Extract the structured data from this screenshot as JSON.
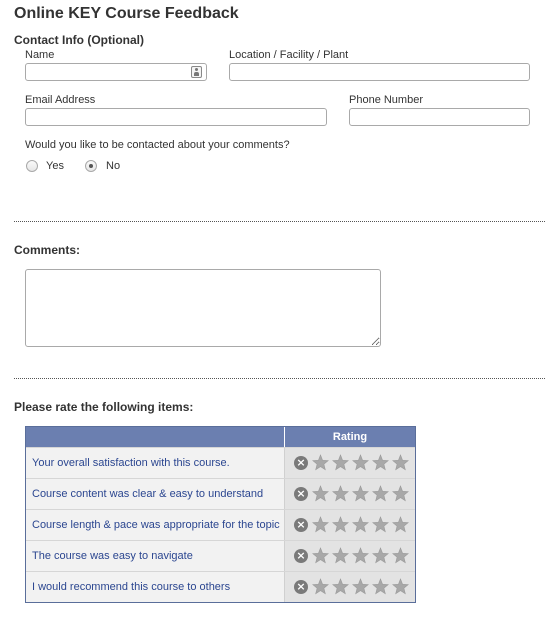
{
  "form": {
    "title": "Online KEY Course Feedback",
    "contact_section": "Contact Info (Optional)",
    "name_label": "Name",
    "name_value": "",
    "location_label": "Location / Facility / Plant",
    "location_value": "",
    "email_label": "Email Address",
    "email_value": "",
    "phone_label": "Phone Number",
    "phone_value": "",
    "contact_question": "Would you like to be contacted about your comments?",
    "contact_options": [
      {
        "label": "Yes",
        "selected": false
      },
      {
        "label": "No",
        "selected": true
      }
    ],
    "comments_label": "Comments:",
    "comments_value": "",
    "rating_prompt": "Please rate the following items:"
  },
  "rating_grid": {
    "column_header": "Rating",
    "max_stars": 5,
    "rows": [
      {
        "text": "Your overall satisfaction with this course.",
        "rating": 0
      },
      {
        "text": "Course content was clear & easy to understand",
        "rating": 0
      },
      {
        "text": "Course length & pace was appropriate for the topic",
        "rating": 0
      },
      {
        "text": "The course was easy to navigate",
        "rating": 0
      },
      {
        "text": "I would recommend this course to others",
        "rating": 0
      }
    ]
  },
  "colors": {
    "grid_header": "#6b7fb0",
    "item_text": "#2b4690",
    "star_empty": "#a8a8a8"
  },
  "icons": {
    "name_field": "contact-card-icon",
    "clear": "clear-rating-icon",
    "star": "star-icon"
  }
}
